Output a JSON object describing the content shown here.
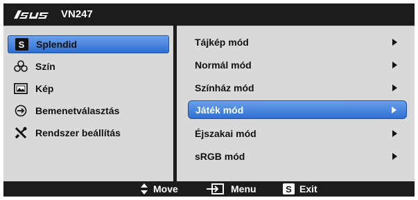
{
  "header": {
    "brand": "/ISUS",
    "model": "VN247"
  },
  "main_menu": {
    "items": [
      {
        "label": "Splendid",
        "icon": "splendid-s-icon",
        "selected": true
      },
      {
        "label": "Szín",
        "icon": "color-circles-icon",
        "selected": false
      },
      {
        "label": "Kép",
        "icon": "picture-icon",
        "selected": false
      },
      {
        "label": "Bemenetválasztás",
        "icon": "input-select-icon",
        "selected": false
      },
      {
        "label": "Rendszer beállítás",
        "icon": "tools-icon",
        "selected": false
      }
    ]
  },
  "sub_menu": {
    "items": [
      {
        "label": "Tájkép mód",
        "selected": false
      },
      {
        "label": "Normál mód",
        "selected": false
      },
      {
        "label": "Színház mód",
        "selected": false
      },
      {
        "label": "Játék mód",
        "selected": true
      },
      {
        "label": "Éjszakai mód",
        "selected": false
      },
      {
        "label": "sRGB mód",
        "selected": false
      }
    ]
  },
  "footer": {
    "move_label": "Move",
    "menu_label": "Menu",
    "exit_label": "Exit",
    "exit_key": "S",
    "splendid_key": "S"
  },
  "colors": {
    "osd_background": "#1c1c1c",
    "panel_background": "#d9d9d9",
    "highlight": "#3f7fe0",
    "text": "#111111"
  }
}
